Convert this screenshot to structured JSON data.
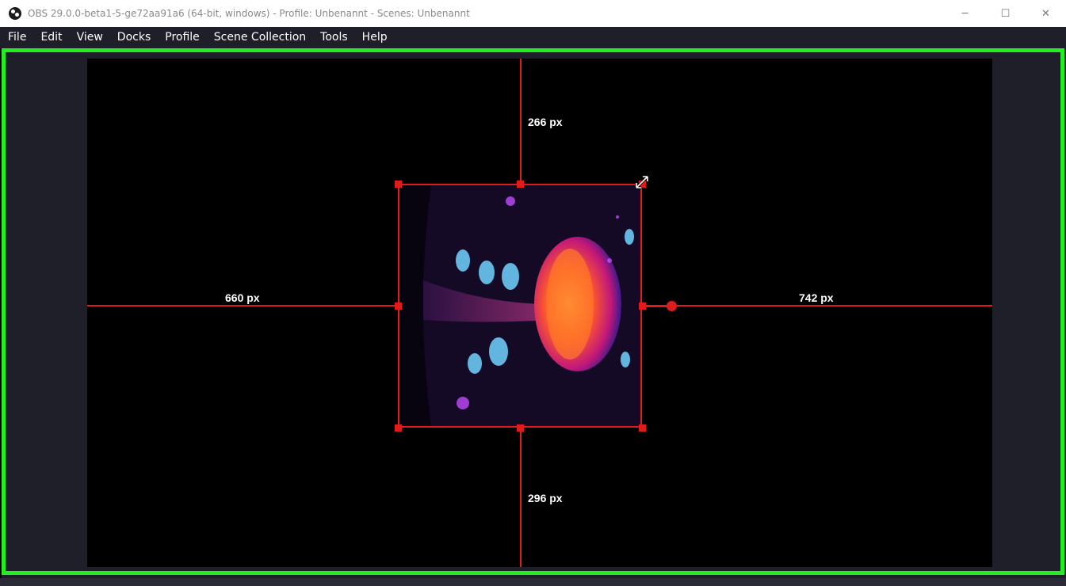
{
  "window": {
    "title": "OBS 29.0.0-beta1-5-ge72aa91a6 (64-bit, windows) - Profile: Unbenannt - Scenes: Unbenannt",
    "app_icon": "obs-logo-icon",
    "controls": {
      "minimize": "─",
      "maximize": "☐",
      "close": "✕"
    }
  },
  "menu": {
    "items": [
      "File",
      "Edit",
      "View",
      "Docks",
      "Profile",
      "Scene Collection",
      "Tools",
      "Help"
    ]
  },
  "preview": {
    "border_color": "#22ee22",
    "guide_color": "#e01b1b",
    "canvas_color": "#000000",
    "source": {
      "description_icon": "psychedelic-mushroom-image",
      "distances": {
        "top": "266 px",
        "left": "660 px",
        "right": "742 px",
        "bottom": "296 px"
      }
    }
  }
}
